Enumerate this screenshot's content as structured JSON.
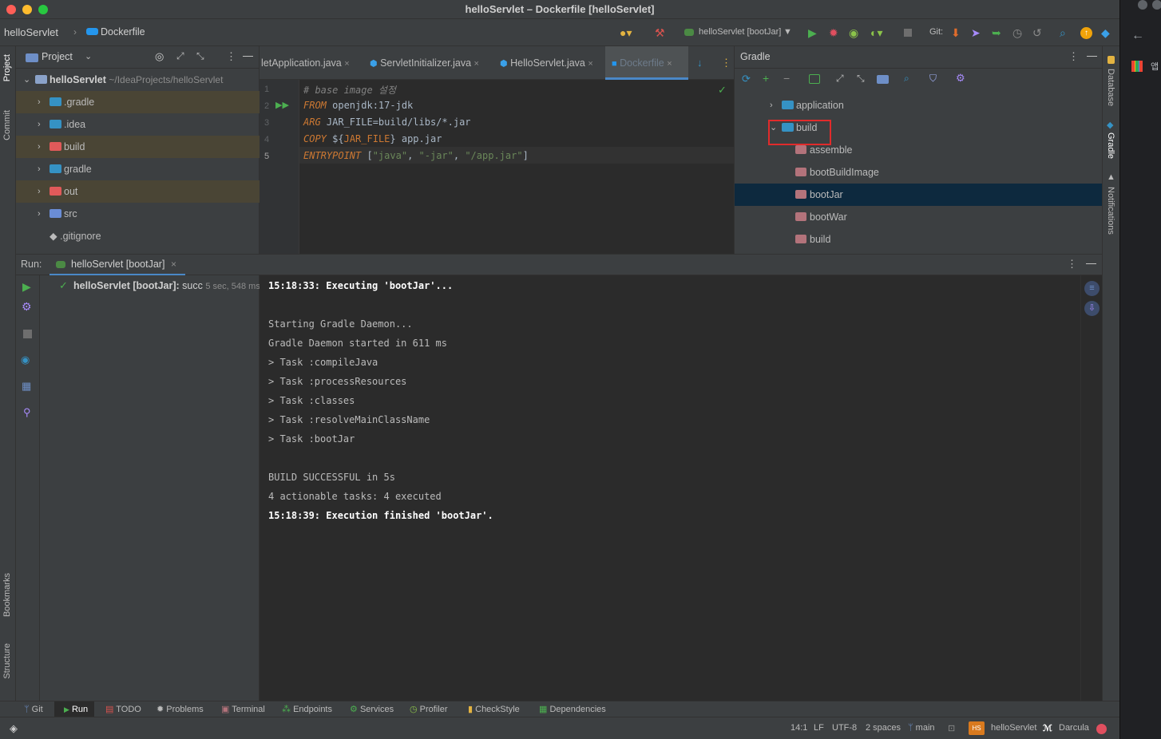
{
  "window": {
    "title": "helloServlet – Dockerfile [helloServlet]"
  },
  "navbar": {
    "project": "helloServlet",
    "file": "Dockerfile",
    "run_config": "helloServlet [bootJar]",
    "git_label": "Git:"
  },
  "left_strip": {
    "project": "Project",
    "commit": "Commit",
    "bookmarks": "Bookmarks",
    "structure": "Structure"
  },
  "right_strip": {
    "database": "Database",
    "gradle": "Gradle",
    "notifications": "Notifications"
  },
  "project_panel": {
    "title": "Project",
    "root": {
      "name": "helloServlet",
      "path": "~/IdeaProjects/helloServlet"
    },
    "items": [
      {
        "label": ".gradle",
        "color": "#3592c4"
      },
      {
        "label": ".idea",
        "color": "#3592c4"
      },
      {
        "label": "build",
        "color": "#e05a5a"
      },
      {
        "label": "gradle",
        "color": "#3592c4"
      },
      {
        "label": "out",
        "color": "#e05a5a"
      },
      {
        "label": "src",
        "color": "#6a8dd6"
      },
      {
        "label": ".gitignore",
        "color": "#bbbbbb"
      }
    ]
  },
  "editor": {
    "tabs": [
      "letApplication.java",
      "ServletInitializer.java",
      "HelloServlet.java",
      "Dockerfile"
    ],
    "line_numbers": [
      "1",
      "2",
      "3",
      "4",
      "5"
    ],
    "code": {
      "l1": "# base image 설정",
      "l2_kw": "FROM",
      "l2_rest": " openjdk:17-jdk",
      "l3_kw": "ARG",
      "l3_rest": " JAR_FILE=build/libs/*.jar",
      "l4_kw": "COPY",
      "l4_a": " ${",
      "l4_var": "JAR_FILE",
      "l4_b": "} app.jar",
      "l5_kw": "ENTRYPOINT",
      "l5_a": " [",
      "l5_s1": "\"java\"",
      "l5_c1": ", ",
      "l5_s2": "\"-jar\"",
      "l5_c2": ", ",
      "l5_s3": "\"/app.jar\"",
      "l5_b": "]"
    }
  },
  "gradle_panel": {
    "title": "Gradle",
    "items": [
      "application",
      "build",
      "assemble",
      "bootBuildImage",
      "bootJar",
      "bootWar",
      "build"
    ]
  },
  "run": {
    "label": "Run:",
    "tab": "helloServlet [bootJar]",
    "tree_name": "helloServlet [bootJar]:",
    "tree_status": "succ",
    "tree_time": "5 sec, 548 ms",
    "console": [
      "15:18:33: Executing 'bootJar'...",
      "",
      "Starting Gradle Daemon...",
      "Gradle Daemon started in 611 ms",
      "> Task :compileJava",
      "> Task :processResources",
      "> Task :classes",
      "> Task :resolveMainClassName",
      "> Task :bootJar",
      "",
      "BUILD SUCCESSFUL in 5s",
      "4 actionable tasks: 4 executed",
      "15:18:39: Execution finished 'bootJar'."
    ]
  },
  "bottom_tabs": [
    "Git",
    "Run",
    "TODO",
    "Problems",
    "Terminal",
    "Endpoints",
    "Services",
    "Profiler",
    "CheckStyle",
    "Dependencies"
  ],
  "status": {
    "position": "14:1",
    "line_sep": "LF",
    "encoding": "UTF-8",
    "indent": "2 spaces",
    "branch": "main",
    "project_badge": "HS",
    "project": "helloServlet",
    "theme": "Darcula"
  },
  "browser": {
    "apps_label": "앱"
  }
}
